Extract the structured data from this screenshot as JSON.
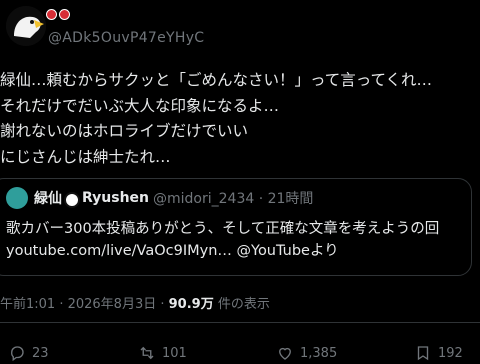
{
  "author": {
    "handle": "@ADk5OuvP47eYHyC"
  },
  "tweet": {
    "lines": [
      "緑仙…頼むからサクッと「ごめんなさい！」って言ってくれ…",
      "それだけでだいぶ大人な印象になるよ…",
      "謝れないのはホロライブだけでいい",
      "にじさんじは紳士たれ…"
    ]
  },
  "quote": {
    "name_part1": "緑仙",
    "name_part2": "Ryushen",
    "handle_time": "@midori_2434 · 21時間",
    "lines": [
      "歌カバー300本投稿ありがとう、そして正確な文章を考えようの回",
      "youtube.com/live/VaOc9IMyn… @YouTubeより"
    ]
  },
  "meta": {
    "time_date": "午前1:01 · 2026年8月3日 · ",
    "views": "90.9万",
    "views_suffix": " 件の表示"
  },
  "actions": {
    "replies": "23",
    "retweets": "101",
    "likes": "1,385",
    "bookmarks": "192"
  },
  "icons": [
    "reply-icon",
    "retweet-icon",
    "like-icon",
    "bookmark-icon"
  ],
  "colors": {
    "background": "#000000",
    "text": "#e7e9ea",
    "muted": "#71767b",
    "border": "#2f3336"
  }
}
